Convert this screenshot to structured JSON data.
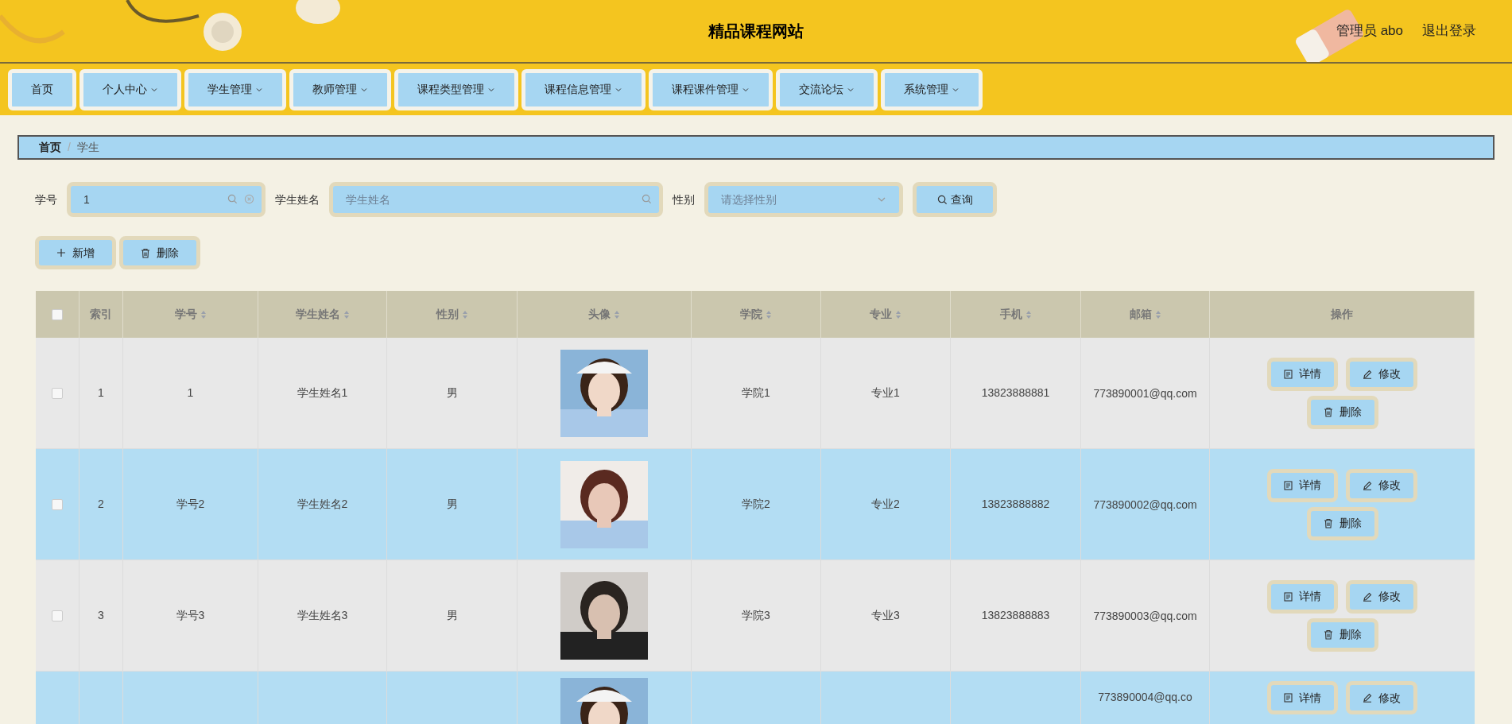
{
  "header": {
    "title": "精品课程网站",
    "user": "管理员 abo",
    "logout": "退出登录"
  },
  "nav": [
    {
      "label": "首页",
      "dropdown": false
    },
    {
      "label": "个人中心",
      "dropdown": true
    },
    {
      "label": "学生管理",
      "dropdown": true
    },
    {
      "label": "教师管理",
      "dropdown": true
    },
    {
      "label": "课程类型管理",
      "dropdown": true
    },
    {
      "label": "课程信息管理",
      "dropdown": true
    },
    {
      "label": "课程课件管理",
      "dropdown": true
    },
    {
      "label": "交流论坛",
      "dropdown": true
    },
    {
      "label": "系统管理",
      "dropdown": true
    }
  ],
  "breadcrumb": {
    "items": [
      {
        "label": "首页"
      },
      {
        "label": "学生"
      }
    ],
    "separator": "/"
  },
  "filters": [
    {
      "label": "学号",
      "kind": "text",
      "value": "1",
      "clearable": true
    },
    {
      "label": "学生姓名",
      "kind": "text",
      "placeholder": "学生姓名",
      "clearable": false
    },
    {
      "label": "性别",
      "kind": "select",
      "placeholder": "请选择性别"
    }
  ],
  "search_button": "查询",
  "actions": [
    "新增",
    "删除"
  ],
  "table": {
    "select_all": {
      "checked": false
    },
    "columns": [
      {
        "label": "索引",
        "sortable": false
      },
      {
        "label": "学号",
        "sortable": true
      },
      {
        "label": "学生姓名",
        "sortable": true
      },
      {
        "label": "性别",
        "sortable": true
      },
      {
        "label": "头像",
        "sortable": true
      },
      {
        "label": "学院",
        "sortable": true
      },
      {
        "label": "专业",
        "sortable": true
      },
      {
        "label": "手机",
        "sortable": true
      },
      {
        "label": "邮箱",
        "sortable": true
      },
      {
        "label": "操作",
        "sortable": false
      }
    ],
    "rows": [
      {
        "checked": false,
        "index": "1",
        "id": "1",
        "name": "学生姓名1",
        "gender": "男",
        "college": "学院1",
        "major": "专业1",
        "phone": "13823888881",
        "email": "773890001@qq.com",
        "buttons": [
          "详情",
          "修改",
          "删除"
        ]
      },
      {
        "checked": false,
        "index": "2",
        "id": "学号2",
        "name": "学生姓名2",
        "gender": "男",
        "college": "学院2",
        "major": "专业2",
        "phone": "13823888882",
        "email": "773890002@qq.com",
        "buttons": [
          "详情",
          "修改",
          "删除"
        ]
      },
      {
        "checked": false,
        "index": "3",
        "id": "学号3",
        "name": "学生姓名3",
        "gender": "男",
        "college": "学院3",
        "major": "专业3",
        "phone": "13823888883",
        "email": "773890003@qq.com",
        "buttons": [
          "详情",
          "修改",
          "删除"
        ]
      },
      {
        "email": "773890004@qq.co",
        "buttons": [
          "详情",
          "修改"
        ]
      }
    ]
  }
}
